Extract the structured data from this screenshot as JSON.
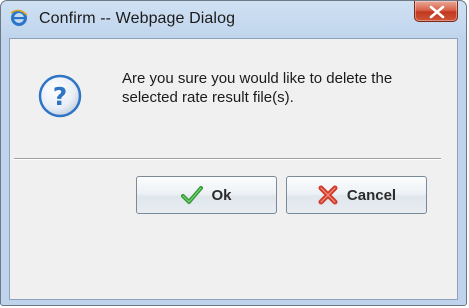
{
  "window": {
    "title": "Confirm -- Webpage Dialog",
    "app_icon": "ie-icon",
    "close_icon": "close-icon"
  },
  "dialog": {
    "icon": "question-icon",
    "message": "Are you sure you would like to delete the selected rate result file(s)."
  },
  "buttons": {
    "ok_label": "Ok",
    "ok_icon": "checkmark-icon",
    "cancel_label": "Cancel",
    "cancel_icon": "red-x-icon"
  },
  "colors": {
    "title_bar": "#c3d7ee",
    "close_button": "#c0391f",
    "dialog_bg": "#f0f0f0",
    "question_icon": "#2f75c6",
    "ok_check": "#2f9a2f",
    "cancel_x": "#d03a2a"
  }
}
